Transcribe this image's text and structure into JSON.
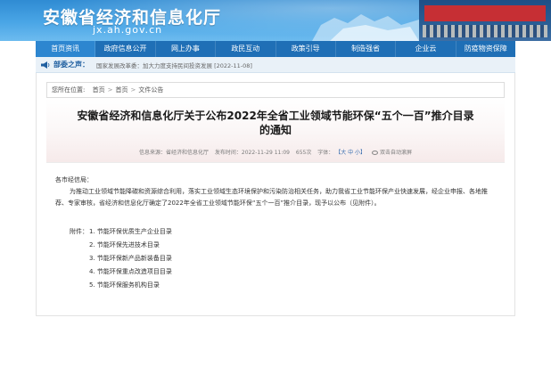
{
  "header": {
    "site_title": "安徽省经济和信息化厅",
    "domain": "jx.ah.gov.cn"
  },
  "nav": {
    "items": [
      "首页资讯",
      "政府信息公开",
      "网上办事",
      "政民互动",
      "政策引导",
      "制造强省",
      "企业云",
      "防疫物资保障"
    ]
  },
  "notice": {
    "label": "部委之声：",
    "text": "国家发展改革委：加大力度支持民间投资发展 [2022-11-08]"
  },
  "breadcrumb": {
    "prefix": "您所在位置:",
    "items": [
      "首页",
      "首页",
      "文件公告"
    ],
    "separator": ">"
  },
  "article": {
    "title_line1": "安徽省经济和信息化厅关于公布2022年全省工业领域节能环保“五个一百”推介目录",
    "title_line2": "的通知",
    "meta": {
      "source": "信息来源：省经济和信息化厅",
      "published": "发布时间：2022-11-29 11:09",
      "views": "655次",
      "font_label": "字体：",
      "font_sizes": "【大 中 小】",
      "read_aloud": "双击自动滚屏"
    },
    "salutation": "各市经信局：",
    "paragraph": "为推动工业领域节能降碳和资源综合利用，落实工业领域生态环境保护和污染防治相关任务，助力我省工业节能环保产业快速发展，经企业申报、各地推荐、专家审核，省经济和信息化厅确定了2022年全省工业领域节能环保“五个一百”推介目录，现予以公布（见附件）。",
    "attachments_label": "附件：",
    "attachments": [
      "1. 节能环保优质生产企业目录",
      "2. 节能环保先进技术目录",
      "3. 节能环保新产品新装备目录",
      "4. 节能环保重点改造项目目录",
      "5. 节能环保服务机构目录"
    ]
  },
  "colors": {
    "nav_bg": "#1f6fb6",
    "banner": "#4aa6e6",
    "accent": "#1f5fa0"
  }
}
